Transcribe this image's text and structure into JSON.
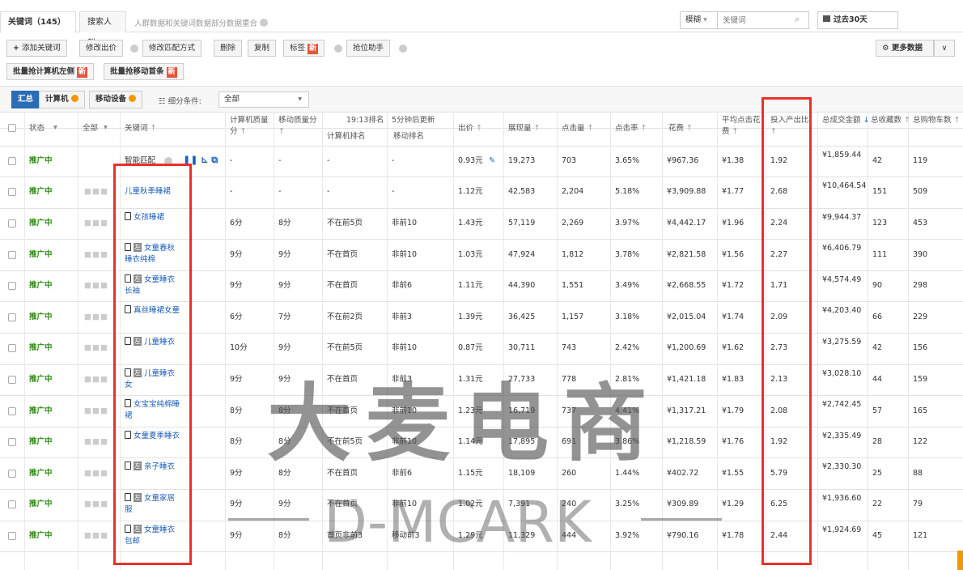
{
  "tabs": [
    {
      "label": "关键词（145）"
    },
    {
      "label": "搜索人群"
    }
  ],
  "tab_note": "人群数据和关键词数据部分数据重合",
  "search": {
    "mode": "模糊",
    "placeholder": "关键词",
    "date_range": "过去30天"
  },
  "toolbar": {
    "add": "添加关键词",
    "edit_bid": "修改出价",
    "edit_match": "修改匹配方式",
    "delete": "删除",
    "copy": "复制",
    "tag": "标签",
    "rank_helper": "抢位助手",
    "more_data": "更多数据",
    "batch_pc": "批量抢计算机左侧",
    "batch_mobile": "批量抢移动首条",
    "new_badge": "新"
  },
  "segment": {
    "summary": "汇总",
    "pc": "计算机",
    "mobile": "移动设备",
    "filter_label": "细分条件:",
    "filter_value": "全部"
  },
  "headers": {
    "status": "状态",
    "all": "全部",
    "keyword": "关键词",
    "pc_quality": "计算机质量分",
    "mobile_quality": "移动质量分",
    "time_rank": "19:13排名",
    "update_note": "5分钟后更新",
    "pc_rank": "计算机排名",
    "mobile_rank": "移动排名",
    "bid": "出价",
    "impressions": "展现量",
    "clicks": "点击量",
    "ctr": "点击率",
    "cost": "花费",
    "avg_cpc": "平均点击花费",
    "roi": "投入产出比",
    "gmv": "总成交金额",
    "fav": "总收藏数",
    "cart": "总购物车数"
  },
  "smart_row": {
    "status": "推广中",
    "keyword": "智能匹配",
    "pc_q": "-",
    "mob_q": "-",
    "pc_rank": "-",
    "mob_rank": "-",
    "bid": "0.93元",
    "impr": "19,273",
    "clicks": "703",
    "ctr": "3.65%",
    "cost": "¥967.36",
    "cpc": "¥1.38",
    "roi": "1.92",
    "gmv": "¥1,859.44",
    "fav": "42",
    "cart": "119"
  },
  "rows": [
    {
      "status": "推广中",
      "mobile": false,
      "left": false,
      "keyword": "儿童秋季睡裙",
      "pc_q": "-",
      "mob_q": "-",
      "pc_rank": "-",
      "mob_rank": "-",
      "bid": "1.12元",
      "impr": "42,583",
      "clicks": "2,204",
      "ctr": "5.18%",
      "cost": "¥3,909.88",
      "cpc": "¥1.77",
      "roi": "2.68",
      "gmv": "¥10,464.54",
      "fav": "151",
      "cart": "509"
    },
    {
      "status": "推广中",
      "mobile": true,
      "left": false,
      "keyword": "女孩睡裙",
      "pc_q": "6分",
      "mob_q": "8分",
      "pc_rank": "不在前5页",
      "mob_rank": "非前10",
      "bid": "1.43元",
      "impr": "57,119",
      "clicks": "2,269",
      "ctr": "3.97%",
      "cost": "¥4,442.17",
      "cpc": "¥1.96",
      "roi": "2.24",
      "gmv": "¥9,944.37",
      "fav": "123",
      "cart": "453"
    },
    {
      "status": "推广中",
      "mobile": true,
      "left": true,
      "keyword": "女童春秋睡衣纯棉",
      "pc_q": "9分",
      "mob_q": "9分",
      "pc_rank": "不在首页",
      "mob_rank": "非前10",
      "bid": "1.03元",
      "impr": "47,924",
      "clicks": "1,812",
      "ctr": "3.78%",
      "cost": "¥2,821.58",
      "cpc": "¥1.56",
      "roi": "2.27",
      "gmv": "¥6,406.79",
      "fav": "111",
      "cart": "390"
    },
    {
      "status": "推广中",
      "mobile": true,
      "left": true,
      "keyword": "女童睡衣长袖",
      "pc_q": "9分",
      "mob_q": "9分",
      "pc_rank": "不在首页",
      "mob_rank": "非前6",
      "bid": "1.11元",
      "impr": "44,390",
      "clicks": "1,551",
      "ctr": "3.49%",
      "cost": "¥2,668.55",
      "cpc": "¥1.72",
      "roi": "1.71",
      "gmv": "¥4,574.49",
      "fav": "90",
      "cart": "298"
    },
    {
      "status": "推广中",
      "mobile": true,
      "left": false,
      "keyword": "真丝睡裙女童",
      "pc_q": "6分",
      "mob_q": "7分",
      "pc_rank": "不在前2页",
      "mob_rank": "非前3",
      "bid": "1.39元",
      "impr": "36,425",
      "clicks": "1,157",
      "ctr": "3.18%",
      "cost": "¥2,015.04",
      "cpc": "¥1.74",
      "roi": "2.09",
      "gmv": "¥4,203.40",
      "fav": "66",
      "cart": "229"
    },
    {
      "status": "推广中",
      "mobile": true,
      "left": true,
      "keyword": "儿童睡衣",
      "pc_q": "10分",
      "mob_q": "9分",
      "pc_rank": "不在前5页",
      "mob_rank": "非前10",
      "bid": "0.87元",
      "impr": "30,711",
      "clicks": "743",
      "ctr": "2.42%",
      "cost": "¥1,200.69",
      "cpc": "¥1.62",
      "roi": "2.73",
      "gmv": "¥3,275.59",
      "fav": "42",
      "cart": "156"
    },
    {
      "status": "推广中",
      "mobile": true,
      "left": true,
      "keyword": "儿童睡衣 女",
      "pc_q": "9分",
      "mob_q": "9分",
      "pc_rank": "不在首页",
      "mob_rank": "非前3",
      "bid": "1.31元",
      "impr": "27,733",
      "clicks": "778",
      "ctr": "2.81%",
      "cost": "¥1,421.18",
      "cpc": "¥1.83",
      "roi": "2.13",
      "gmv": "¥3,028.10",
      "fav": "44",
      "cart": "159"
    },
    {
      "status": "推广中",
      "mobile": true,
      "left": false,
      "keyword": "女宝宝纯棉睡裙",
      "pc_q": "8分",
      "mob_q": "8分",
      "pc_rank": "不在首页",
      "mob_rank": "非前10",
      "bid": "1.23元",
      "impr": "16,719",
      "clicks": "737",
      "ctr": "4.41%",
      "cost": "¥1,317.21",
      "cpc": "¥1.79",
      "roi": "2.08",
      "gmv": "¥2,742.45",
      "fav": "57",
      "cart": "165"
    },
    {
      "status": "推广中",
      "mobile": true,
      "left": false,
      "keyword": "女童夏季睡衣",
      "pc_q": "8分",
      "mob_q": "8分",
      "pc_rank": "不在前5页",
      "mob_rank": "非前10",
      "bid": "1.14元",
      "impr": "17,895",
      "clicks": "691",
      "ctr": "3.86%",
      "cost": "¥1,218.59",
      "cpc": "¥1.76",
      "roi": "1.92",
      "gmv": "¥2,335.49",
      "fav": "28",
      "cart": "122"
    },
    {
      "status": "推广中",
      "mobile": true,
      "left": true,
      "keyword": "亲子睡衣",
      "pc_q": "9分",
      "mob_q": "8分",
      "pc_rank": "不在首页",
      "mob_rank": "非前6",
      "bid": "1.15元",
      "impr": "18,109",
      "clicks": "260",
      "ctr": "1.44%",
      "cost": "¥402.72",
      "cpc": "¥1.55",
      "roi": "5.79",
      "gmv": "¥2,330.30",
      "fav": "25",
      "cart": "88"
    },
    {
      "status": "推广中",
      "mobile": true,
      "left": true,
      "keyword": "女童家居服",
      "pc_q": "9分",
      "mob_q": "9分",
      "pc_rank": "不在首页",
      "mob_rank": "非前10",
      "bid": "1.02元",
      "impr": "7,391",
      "clicks": "240",
      "ctr": "3.25%",
      "cost": "¥309.89",
      "cpc": "¥1.29",
      "roi": "6.25",
      "gmv": "¥1,936.60",
      "fav": "22",
      "cart": "79"
    },
    {
      "status": "推广中",
      "mobile": true,
      "left": true,
      "keyword": "女童睡衣包邮",
      "pc_q": "9分",
      "mob_q": "8分",
      "pc_rank": "首页非前3",
      "mob_rank": "移动前3",
      "bid": "1.29元",
      "impr": "11,329",
      "clicks": "444",
      "ctr": "3.92%",
      "cost": "¥790.16",
      "cpc": "¥1.78",
      "roi": "2.44",
      "gmv": "¥1,924.69",
      "fav": "45",
      "cart": "121"
    }
  ],
  "watermark": {
    "cn": "大麦电商",
    "en": "D-MCARK"
  },
  "colors": {
    "status_green": "#2e8b12",
    "highlight": "#fffbdb",
    "red_box": "#e8322b",
    "link": "#1f5fb8",
    "new_badge": "#e6543a"
  }
}
